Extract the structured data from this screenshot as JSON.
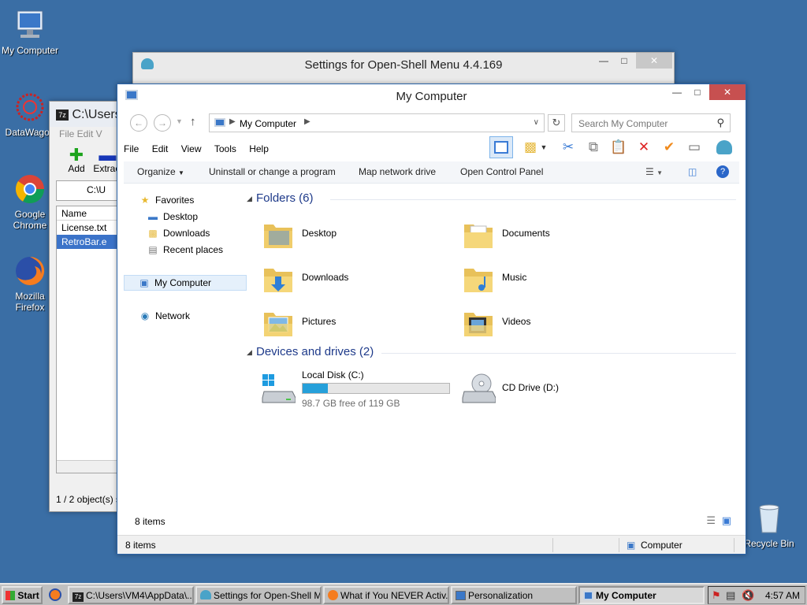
{
  "desktop": {
    "icons": [
      {
        "label": "My Computer"
      },
      {
        "label": "DataWagon"
      },
      {
        "label": "Google Chrome"
      },
      {
        "label": "Mozilla Firefox"
      },
      {
        "label": "Recycle Bin"
      }
    ]
  },
  "settings_window": {
    "title": "Settings for Open-Shell Menu 4.4.169"
  },
  "sevenzip_window": {
    "title": "C:\\Users\\",
    "menu": "File  Edit  V",
    "add_label": "Add",
    "extract_label": "Extract",
    "address": "C:\\U",
    "column_name": "Name",
    "files": [
      "License.txt",
      "RetroBar.e"
    ],
    "status": "1 / 2 object(s) s"
  },
  "explorer": {
    "title": "My Computer",
    "address": "My Computer",
    "search_placeholder": "Search My Computer",
    "menu": [
      "File",
      "Edit",
      "View",
      "Tools",
      "Help"
    ],
    "commands": {
      "organize": "Organize",
      "uninstall": "Uninstall or change a program",
      "map_drive": "Map network drive",
      "control_panel": "Open Control Panel"
    },
    "sidebar": {
      "favorites": "Favorites",
      "desktop": "Desktop",
      "downloads": "Downloads",
      "recent": "Recent places",
      "my_computer": "My Computer",
      "network": "Network"
    },
    "folders_header": "Folders (6)",
    "folders": [
      "Desktop",
      "Documents",
      "Downloads",
      "Music",
      "Pictures",
      "Videos"
    ],
    "devices_header": "Devices and drives (2)",
    "drives": {
      "c_label": "Local Disk (C:)",
      "c_free": "98.7 GB free of 119 GB",
      "c_used_fraction": 0.17,
      "d_label": "CD Drive (D:)"
    },
    "item_count": "8 items",
    "status_count": "8 items",
    "status_location": "Computer"
  },
  "taskbar": {
    "start": "Start",
    "buttons": [
      "C:\\Users\\VM4\\AppData\\...",
      "Settings for Open-Shell M...",
      "What if You NEVER Activ...",
      "Personalization",
      "My Computer"
    ],
    "clock": "4:57 AM"
  },
  "colors": {
    "desktop": "#3a6ea5",
    "accent": "#26a0da",
    "close": "#c75050",
    "header_blue": "#1e3a8a"
  }
}
